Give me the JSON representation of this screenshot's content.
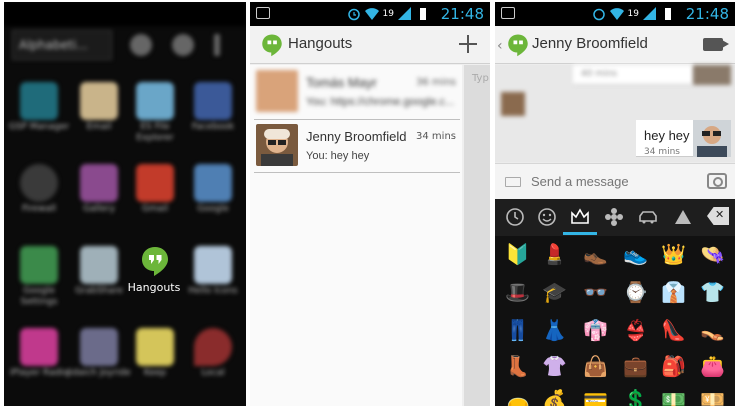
{
  "status_bar": {
    "time": "21:48",
    "battery_level": "19"
  },
  "launcher": {
    "apps_dropdown": "Alphabeti...",
    "highlight_app_label": "Hangouts",
    "blurred_labels": [
      "GSP Manager",
      "Email",
      "ES File Explorer",
      "Facebook",
      "Firewall",
      "Gallery",
      "Gmail",
      "Google",
      "Google Settings",
      "GrabShare",
      "Hangouts",
      "Hello Icons",
      "iPlayer Radio",
      "Jidaich Joyride",
      "Keep",
      "Local"
    ]
  },
  "hangouts_list": {
    "title": "Hangouts",
    "conversations": [
      {
        "name": "Tomás Mayr",
        "time": "36 mins",
        "preview": "You: https://chrome.google.c..."
      },
      {
        "name": "Jenny Broomfield",
        "time": "34 mins",
        "preview": "You: hey hey"
      }
    ],
    "side_peek_label": "Typ"
  },
  "conversation": {
    "contact_name": "Jenny Broomfield",
    "earlier_time": "40 mins",
    "message_text": "hey hey",
    "message_time": "34 mins",
    "composer_placeholder": "Send a message"
  },
  "emoji_keyboard": {
    "tabs": [
      "recent-icon",
      "smiley-icon",
      "crown-icon",
      "flower-icon",
      "car-icon",
      "symbols-icon",
      "delete-icon"
    ],
    "active_tab": "crown-icon",
    "emojis": [
      "🔰",
      "💄",
      "👞",
      "👟",
      "👑",
      "👒",
      "🎩",
      "🎓",
      "👓",
      "⌚",
      "👔",
      "👕",
      "👖",
      "👗",
      "👘",
      "👙",
      "👠",
      "👡",
      "👢",
      "👚",
      "👜",
      "💼",
      "🎒",
      "👛",
      "👝",
      "💰",
      "💳",
      "💲",
      "💵",
      "💴"
    ]
  },
  "colors": {
    "accent": "#33b5e5",
    "hangouts_green": "#6cb63a"
  }
}
